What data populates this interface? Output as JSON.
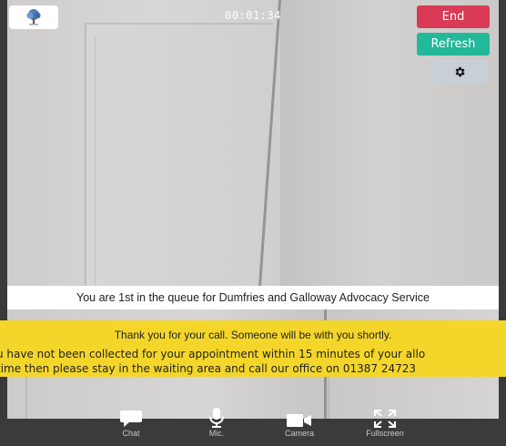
{
  "header": {
    "timer": "00:01:34",
    "logo_icon": "tree-logo-icon"
  },
  "controls": {
    "end_label": "End",
    "refresh_label": "Refresh",
    "settings_icon": "gear-icon"
  },
  "status": {
    "queue_text": "You are 1st in the queue for Dumfries and Galloway Advocacy Service"
  },
  "notice": {
    "line1": "Thank you for your call. Someone will be with you shortly.",
    "line2": "u have not been collected for your appointment within 15 minutes of your allo",
    "line3": "time then please stay in the waiting area and call our office on 01387 24723"
  },
  "toolbar": {
    "items": [
      {
        "label": "Chat",
        "icon": "chat-bubble-icon"
      },
      {
        "label": "Mic.",
        "icon": "microphone-icon"
      },
      {
        "label": "Camera",
        "icon": "video-camera-icon"
      },
      {
        "label": "Fullscreen",
        "icon": "fullscreen-icon"
      }
    ]
  },
  "colors": {
    "end": "#d93a56",
    "refresh": "#22b89a",
    "settings": "#c9cfd6",
    "notice_bg": "#f4d62b",
    "toolbar_bg": "#3b3b3b"
  }
}
